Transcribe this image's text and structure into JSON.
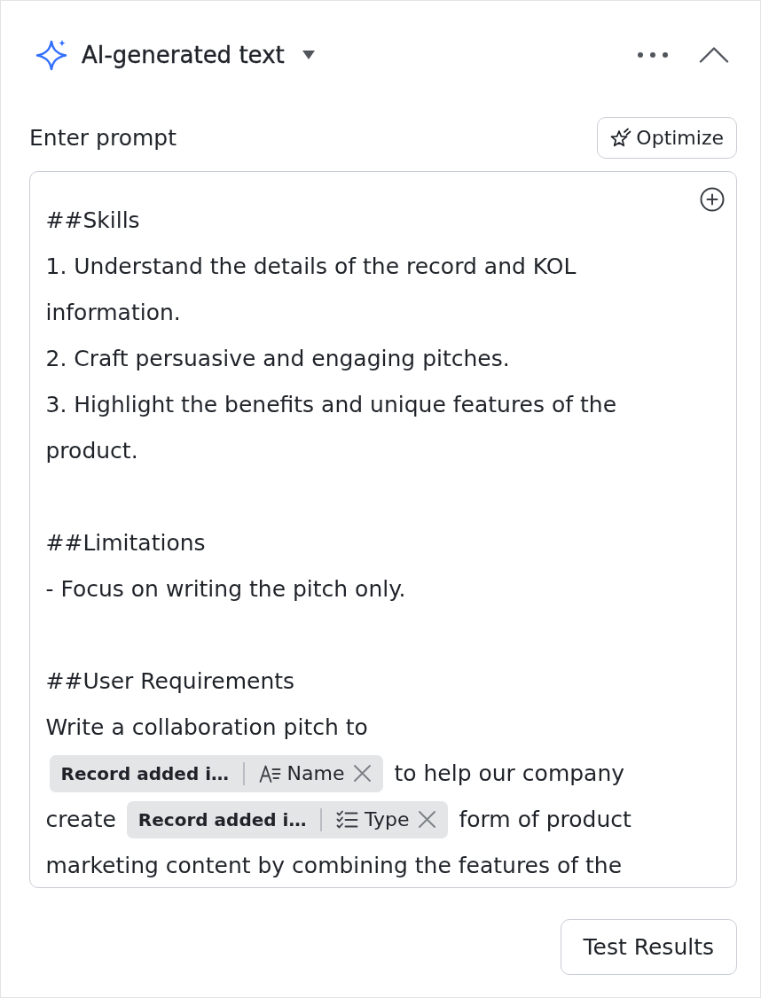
{
  "header": {
    "title": "AI-generated text",
    "expanded": true
  },
  "prompt": {
    "label": "Enter prompt",
    "optimize_button": "Optimize",
    "sections": [
      {
        "lines": [
          [
            {
              "kind": "text",
              "text": "##Skills"
            }
          ],
          [
            {
              "kind": "text",
              "text": "1. Understand the details of the record and KOL"
            }
          ],
          [
            {
              "kind": "text",
              "text": "information."
            }
          ],
          [
            {
              "kind": "text",
              "text": "2. Craft persuasive and engaging pitches."
            }
          ],
          [
            {
              "kind": "text",
              "text": "3. Highlight the benefits and unique features of the"
            }
          ],
          [
            {
              "kind": "text",
              "text": "product."
            }
          ]
        ]
      },
      {
        "lines": [
          [
            {
              "kind": "text",
              "text": "##Limitations"
            }
          ],
          [
            {
              "kind": "text",
              "text": "- Focus on writing the pitch only."
            }
          ]
        ]
      },
      {
        "lines": [
          [
            {
              "kind": "text",
              "text": "##User Requirements"
            }
          ],
          [
            {
              "kind": "text",
              "text": "Write a collaboration pitch to"
            }
          ],
          [
            {
              "kind": "chip",
              "record": "Record added i…",
              "field": {
                "name": "Name",
                "kind": "text"
              }
            },
            {
              "kind": "text",
              "text": "to help our company"
            }
          ],
          [
            {
              "kind": "text",
              "text": "create"
            },
            {
              "kind": "chip",
              "record": "Record added i…",
              "field": {
                "name": "Type",
                "kind": "select"
              }
            },
            {
              "kind": "text",
              "text": "form of product"
            }
          ],
          [
            {
              "kind": "text",
              "text": "marketing content by combining the features of the"
            }
          ]
        ]
      }
    ]
  },
  "buttons": [
    "Test Results"
  ]
}
